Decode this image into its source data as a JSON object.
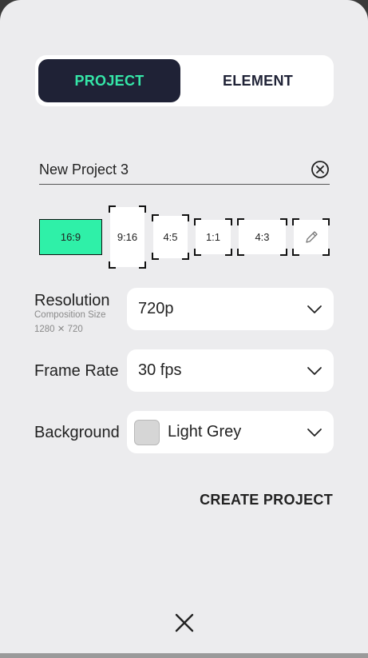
{
  "tabs": {
    "project": "PROJECT",
    "element": "ELEMENT"
  },
  "project_name": {
    "value": "New Project 3"
  },
  "aspect_ratios": {
    "r16_9": "16:9",
    "r9_16": "9:16",
    "r4_5": "4:5",
    "r1_1": "1:1",
    "r4_3": "4:3",
    "selected": "16:9"
  },
  "resolution": {
    "label": "Resolution",
    "sublabel": "Composition Size",
    "size": "1280 ✕ 720",
    "value": "720p"
  },
  "frame_rate": {
    "label": "Frame Rate",
    "value": "30 fps"
  },
  "background": {
    "label": "Background",
    "value": "Light Grey",
    "swatch_color": "#d6d6d6"
  },
  "actions": {
    "create": "CREATE PROJECT"
  },
  "colors": {
    "accent": "#2ff0a8",
    "dark": "#1f2236"
  }
}
